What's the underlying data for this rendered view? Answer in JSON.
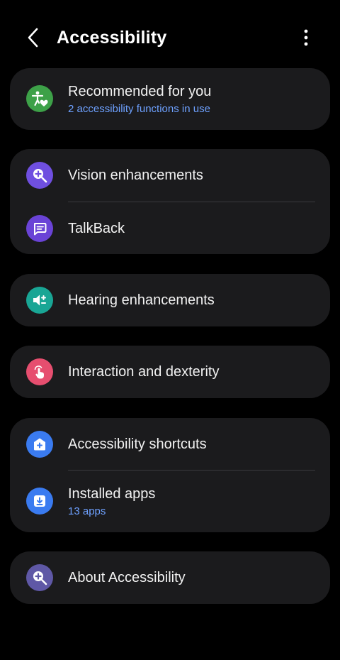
{
  "header": {
    "title": "Accessibility"
  },
  "colors": {
    "link": "#6ea1ff",
    "recommended": "#3da148",
    "vision": "#6f4fe0",
    "talkback": "#6a43d6",
    "hearing": "#19a695",
    "interaction": "#e64e6f",
    "shortcuts": "#3a7bf0",
    "installed": "#3a7bf0",
    "about": "#5f58a6"
  },
  "rows": {
    "recommended": {
      "title": "Recommended for you",
      "subtitle": "2 accessibility functions in use",
      "icon": "accessibility-person-heart-icon"
    },
    "vision": {
      "title": "Vision enhancements",
      "icon": "zoom-plus-icon"
    },
    "talkback": {
      "title": "TalkBack",
      "icon": "speech-bubble-icon"
    },
    "hearing": {
      "title": "Hearing enhancements",
      "icon": "speaker-plus-minus-icon"
    },
    "interaction": {
      "title": "Interaction and dexterity",
      "icon": "tap-hand-icon"
    },
    "shortcuts": {
      "title": "Accessibility shortcuts",
      "icon": "home-plus-icon"
    },
    "installed": {
      "title": "Installed apps",
      "subtitle": "13 apps",
      "icon": "download-tray-icon"
    },
    "about": {
      "title": "About Accessibility",
      "icon": "zoom-plus-icon"
    }
  }
}
